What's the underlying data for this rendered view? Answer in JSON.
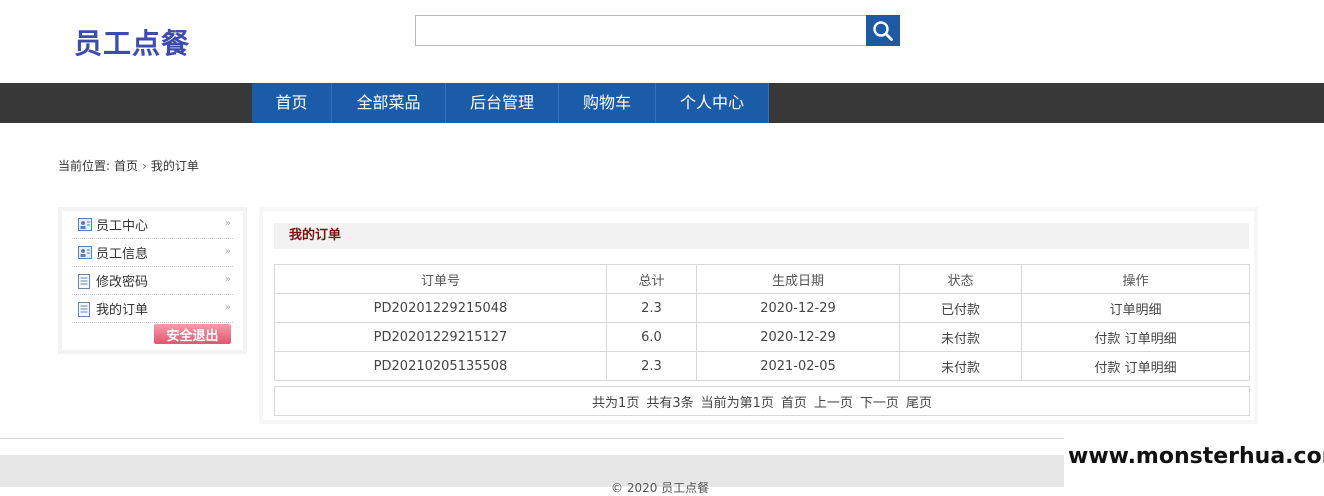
{
  "header": {
    "logo": "员工点餐",
    "search": {
      "placeholder": "",
      "value": ""
    }
  },
  "nav": {
    "items": [
      {
        "label": "首页"
      },
      {
        "label": "全部菜品"
      },
      {
        "label": "后台管理"
      },
      {
        "label": "购物车"
      },
      {
        "label": "个人中心"
      }
    ]
  },
  "breadcrumb": {
    "prefix": "当前位置:",
    "home": "首页",
    "current": "我的订单"
  },
  "sidebar": {
    "items": [
      {
        "label": "员工中心",
        "icon": "profile-card-icon"
      },
      {
        "label": "员工信息",
        "icon": "profile-card-icon"
      },
      {
        "label": "修改密码",
        "icon": "document-icon"
      },
      {
        "label": "我的订单",
        "icon": "document-icon"
      }
    ],
    "logout_label": "安全退出"
  },
  "orders": {
    "title": "我的订单",
    "columns": [
      "订单号",
      "总计",
      "生成日期",
      "状态",
      "操作"
    ],
    "rows": [
      {
        "order_no": "PD20201229215048",
        "total": "2.3",
        "date": "2020-12-29",
        "status": "已付款",
        "pay": "",
        "detail": "订单明细"
      },
      {
        "order_no": "PD20201229215127",
        "total": "6.0",
        "date": "2020-12-29",
        "status": "未付款",
        "pay": "付款",
        "detail": "订单明细"
      },
      {
        "order_no": "PD20210205135508",
        "total": "2.3",
        "date": "2021-02-05",
        "status": "未付款",
        "pay": "付款",
        "detail": "订单明细"
      }
    ]
  },
  "pager": {
    "total_pages": "共为1页",
    "total_items": "共有3条",
    "current": "当前为第1页",
    "first": "首页",
    "prev": "上一页",
    "next": "下一页",
    "last": "尾页"
  },
  "footer": {
    "copyright": "© 2020 员工点餐"
  },
  "watermark": "www.monsterhua.com",
  "colors": {
    "brand": "#3b4bb0",
    "nav_blue": "#1a5ca8",
    "nav_bar": "#383838",
    "title_red": "#7a1010"
  }
}
